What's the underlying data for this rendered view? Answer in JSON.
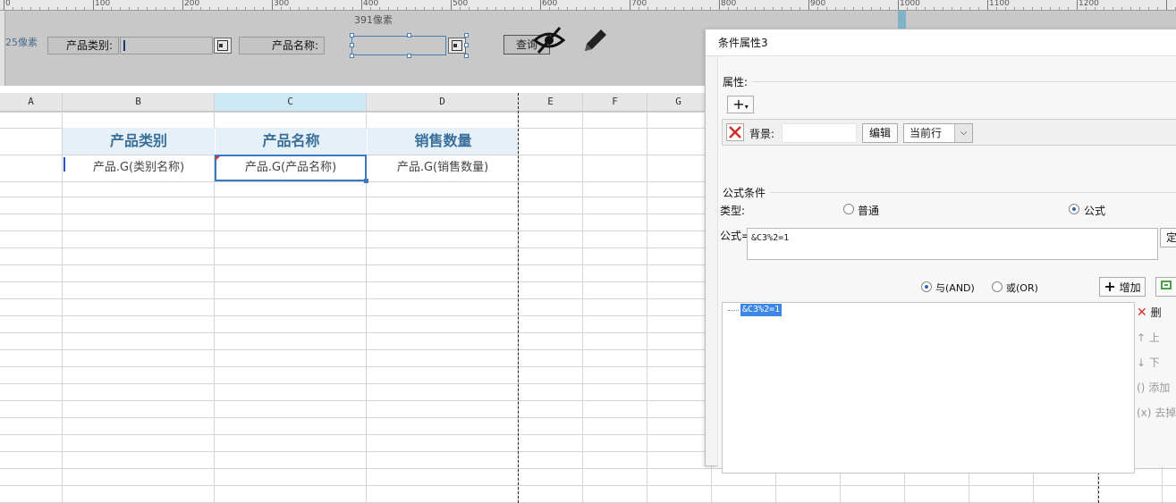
{
  "ruler": {
    "numbers": [
      "0",
      "100",
      "200",
      "300",
      "400",
      "500",
      "600",
      "700",
      "800",
      "900",
      "1000",
      "1100",
      "1200"
    ],
    "width_marker": "391像素",
    "height_marker": "25像素"
  },
  "params": {
    "category_label": "产品类别:",
    "name_label": "产品名称:",
    "query_button": "查询"
  },
  "sheet": {
    "columns": [
      "A",
      "B",
      "C",
      "D",
      "E",
      "F",
      "G"
    ],
    "header_row": [
      "产品类别",
      "产品名称",
      "销售数量"
    ],
    "data_row": [
      "产品.G(类别名称)",
      "产品.G(产品名称)",
      "产品.G(销售数量)"
    ]
  },
  "dialog": {
    "title": "条件属性3",
    "attributes_section": "属性:",
    "bg_label": "背景:",
    "edit_button": "编辑",
    "scope_select": "当前行",
    "formula_condition_section": "公式条件",
    "type_label": "类型:",
    "type_normal": "普通",
    "type_formula": "公式",
    "formula_label": "公式=",
    "formula_value": "&C3%2=1",
    "formula_confirm": "定",
    "logic_and": "与(AND)",
    "logic_or": "或(OR)",
    "add_button": "增加",
    "condition_items": [
      "&C3%2=1"
    ],
    "side_buttons": [
      "删",
      "上",
      "下",
      "添加",
      "去掉"
    ]
  },
  "colors": {
    "header_text": "#3a6f9c",
    "header_bg": "#e5f0f8",
    "selection": "#3b78c4"
  }
}
